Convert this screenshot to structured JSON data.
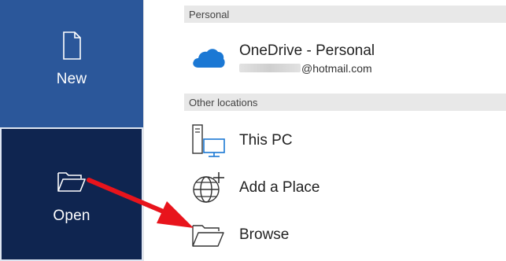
{
  "nav": {
    "new_label": "New",
    "open_label": "Open"
  },
  "sections": {
    "personal": "Personal",
    "other": "Other locations"
  },
  "locations": {
    "onedrive": {
      "title": "OneDrive - Personal",
      "email_suffix": "@hotmail.com"
    },
    "this_pc": {
      "title": "This PC"
    },
    "add_place": {
      "title": "Add a Place"
    },
    "browse": {
      "title": "Browse"
    }
  },
  "colors": {
    "nav_bg": "#2b579a",
    "nav_selected_bg": "#0f2550",
    "onedrive_blue": "#1b78d4",
    "arrow_red": "#e8141c"
  },
  "icons": {
    "new": "new-document-icon",
    "open": "open-folder-icon",
    "onedrive": "onedrive-cloud-icon",
    "this_pc": "this-pc-icon",
    "add_place": "globe-add-icon",
    "browse": "folder-icon"
  }
}
